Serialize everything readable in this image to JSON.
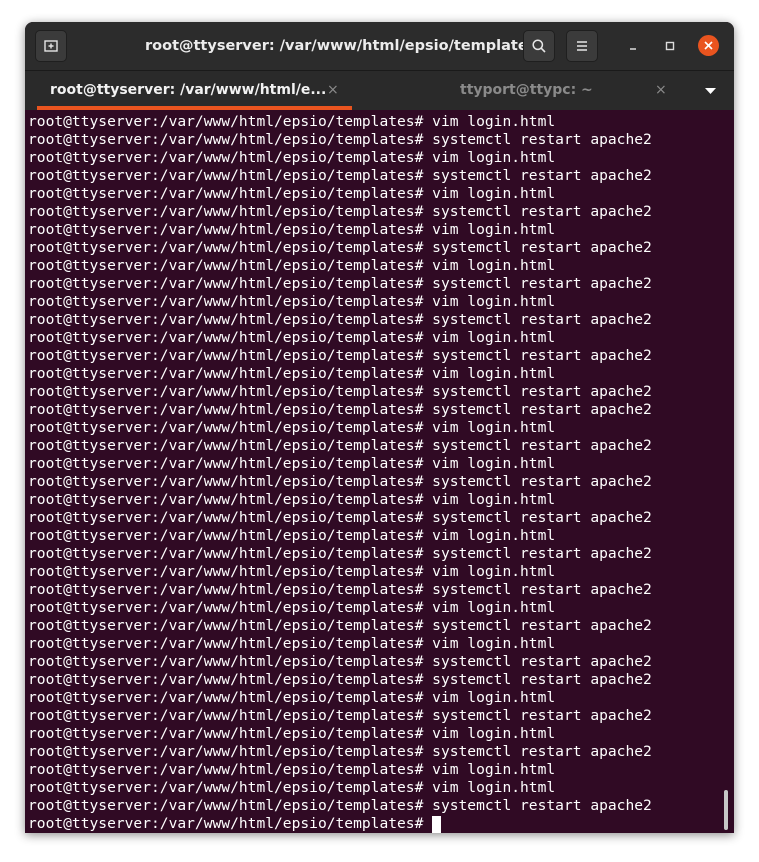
{
  "window": {
    "title": "root@ttyserver: /var/www/html/epsio/templates"
  },
  "tabs": [
    {
      "label": "root@ttyserver: /var/www/html/e...",
      "close": "×",
      "active": true
    },
    {
      "label": "ttyport@ttypc: ~",
      "close": "×",
      "active": false
    }
  ],
  "icons": {
    "new_tab": "new-tab-icon",
    "search": "search-icon",
    "menu": "hamburger-menu-icon",
    "minimize": "minimize-icon",
    "maximize": "maximize-icon",
    "close": "close-icon",
    "tab_menu": "chevron-down-icon"
  },
  "colors": {
    "terminal_bg": "#300a24",
    "accent": "#e9541f",
    "titlebar": "#2c2c2c",
    "text": "#ffffff"
  },
  "terminal": {
    "lines": [
      "root@ttyserver:/var/www/html/epsio/templates# vim login.html",
      "root@ttyserver:/var/www/html/epsio/templates# systemctl restart apache2",
      "root@ttyserver:/var/www/html/epsio/templates# vim login.html",
      "root@ttyserver:/var/www/html/epsio/templates# systemctl restart apache2",
      "root@ttyserver:/var/www/html/epsio/templates# vim login.html",
      "root@ttyserver:/var/www/html/epsio/templates# systemctl restart apache2",
      "root@ttyserver:/var/www/html/epsio/templates# vim login.html",
      "root@ttyserver:/var/www/html/epsio/templates# systemctl restart apache2",
      "root@ttyserver:/var/www/html/epsio/templates# vim login.html",
      "root@ttyserver:/var/www/html/epsio/templates# systemctl restart apache2",
      "root@ttyserver:/var/www/html/epsio/templates# vim login.html",
      "root@ttyserver:/var/www/html/epsio/templates# systemctl restart apache2",
      "root@ttyserver:/var/www/html/epsio/templates# vim login.html",
      "root@ttyserver:/var/www/html/epsio/templates# systemctl restart apache2",
      "root@ttyserver:/var/www/html/epsio/templates# vim login.html",
      "root@ttyserver:/var/www/html/epsio/templates# systemctl restart apache2",
      "root@ttyserver:/var/www/html/epsio/templates# systemctl restart apache2",
      "root@ttyserver:/var/www/html/epsio/templates# vim login.html",
      "root@ttyserver:/var/www/html/epsio/templates# systemctl restart apache2",
      "root@ttyserver:/var/www/html/epsio/templates# vim login.html",
      "root@ttyserver:/var/www/html/epsio/templates# systemctl restart apache2",
      "root@ttyserver:/var/www/html/epsio/templates# vim login.html",
      "root@ttyserver:/var/www/html/epsio/templates# systemctl restart apache2",
      "root@ttyserver:/var/www/html/epsio/templates# vim login.html",
      "root@ttyserver:/var/www/html/epsio/templates# systemctl restart apache2",
      "root@ttyserver:/var/www/html/epsio/templates# vim login.html",
      "root@ttyserver:/var/www/html/epsio/templates# systemctl restart apache2",
      "root@ttyserver:/var/www/html/epsio/templates# vim login.html",
      "root@ttyserver:/var/www/html/epsio/templates# systemctl restart apache2",
      "root@ttyserver:/var/www/html/epsio/templates# vim login.html",
      "root@ttyserver:/var/www/html/epsio/templates# systemctl restart apache2",
      "root@ttyserver:/var/www/html/epsio/templates# systemctl restart apache2",
      "root@ttyserver:/var/www/html/epsio/templates# vim login.html",
      "root@ttyserver:/var/www/html/epsio/templates# systemctl restart apache2",
      "root@ttyserver:/var/www/html/epsio/templates# vim login.html",
      "root@ttyserver:/var/www/html/epsio/templates# systemctl restart apache2",
      "root@ttyserver:/var/www/html/epsio/templates# vim login.html",
      "root@ttyserver:/var/www/html/epsio/templates# vim login.html",
      "root@ttyserver:/var/www/html/epsio/templates# systemctl restart apache2"
    ],
    "prompt": "root@ttyserver:/var/www/html/epsio/templates# "
  }
}
